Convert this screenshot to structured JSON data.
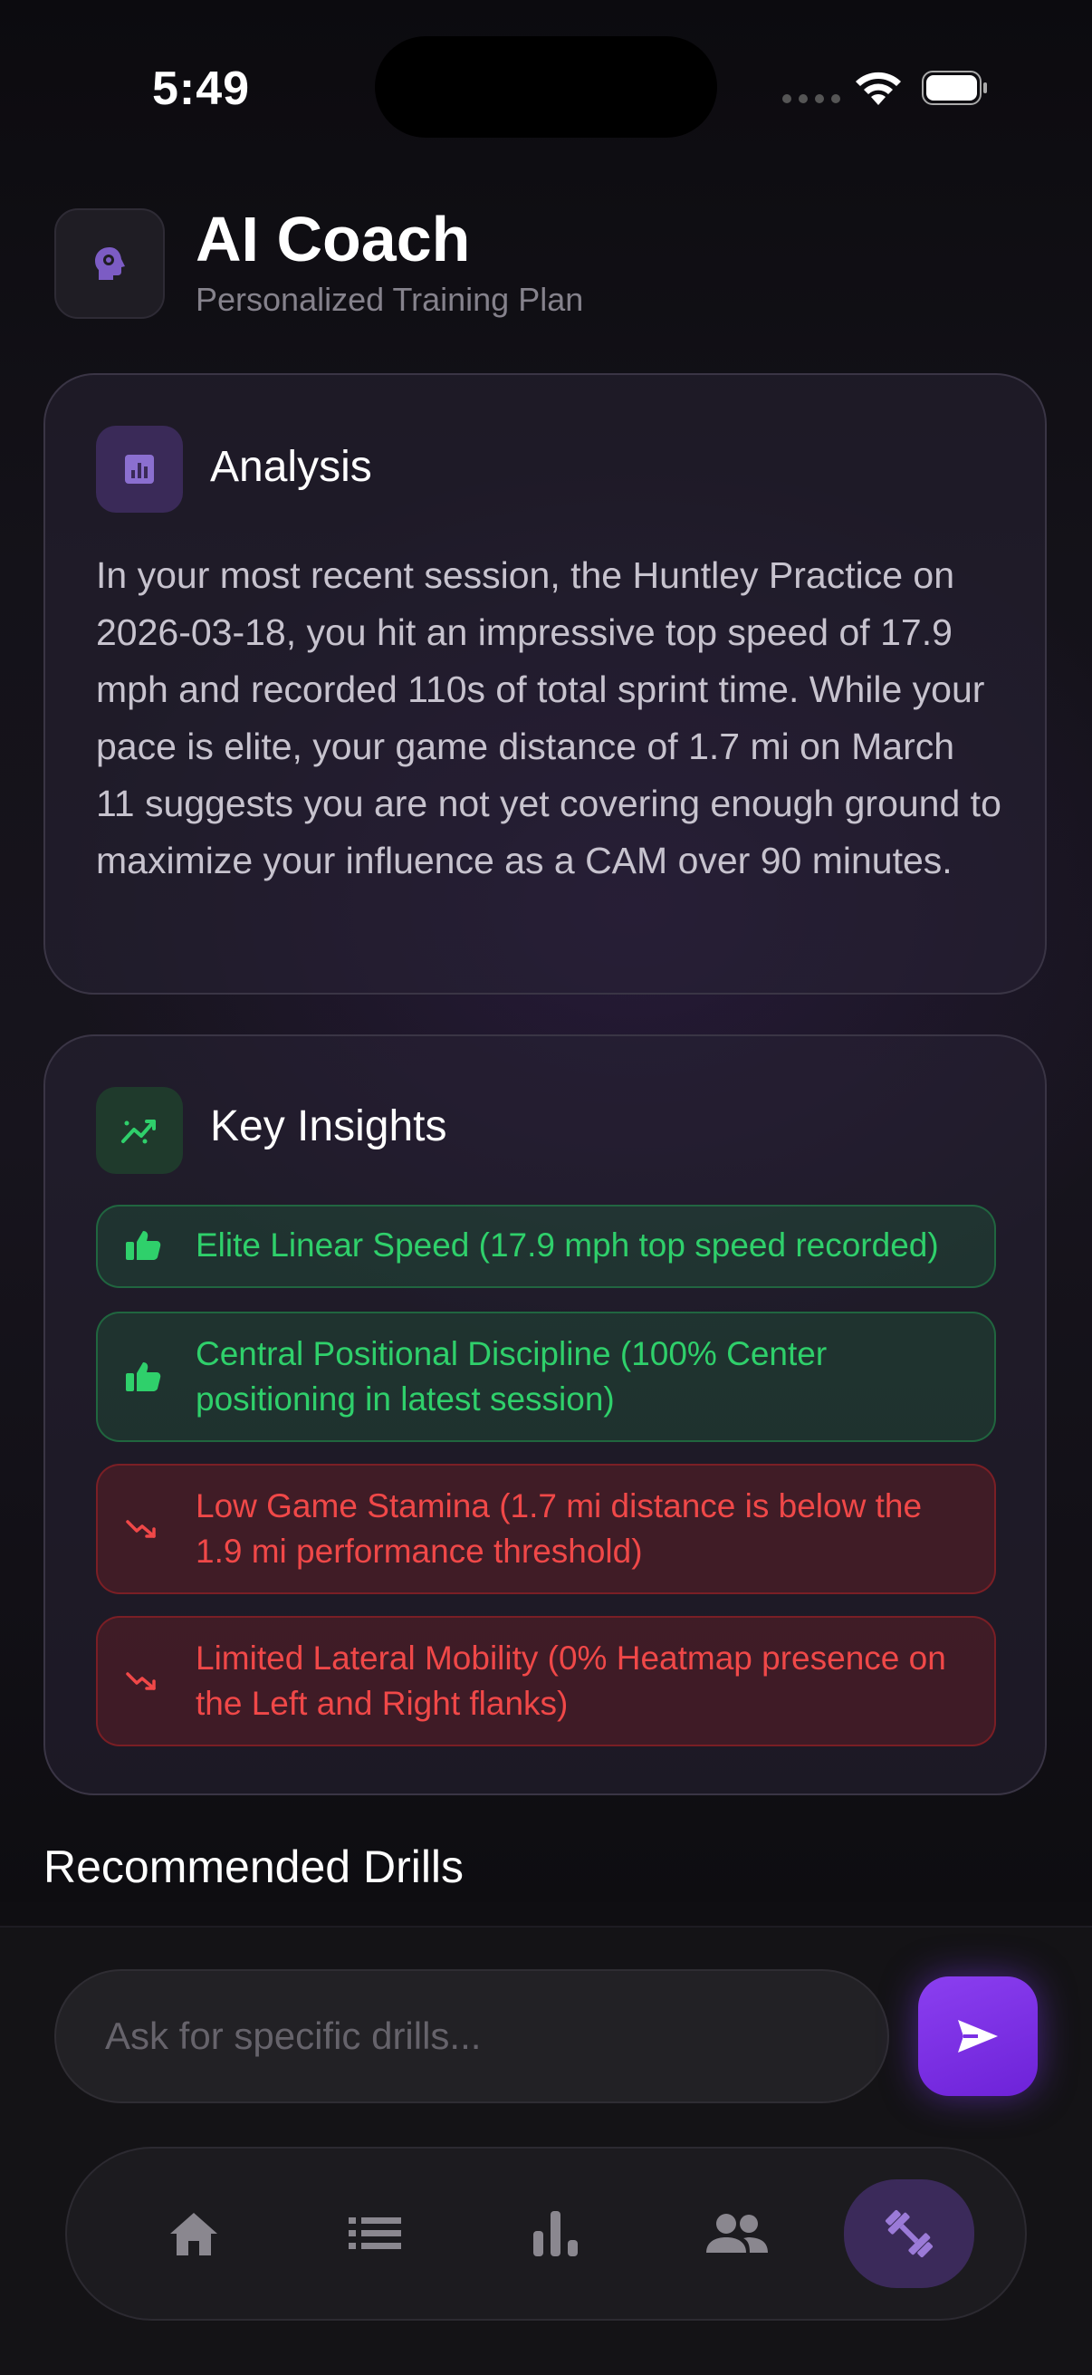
{
  "status_bar": {
    "time": "5:49"
  },
  "header": {
    "title": "AI Coach",
    "subtitle": "Personalized Training Plan"
  },
  "analysis": {
    "title": "Analysis",
    "body": "In your most recent session, the Huntley Practice on 2026-03-18, you hit an impressive top speed of 17.9 mph and recorded 110s of total sprint time. While your pace is elite, your game distance of 1.7 mi on March 11 suggests you are not yet covering enough ground to maximize your influence as a CAM over 90 minutes."
  },
  "insights": {
    "title": "Key Insights",
    "items": [
      {
        "text": "Elite Linear Speed (17.9 mph top speed recorded)",
        "type": "positive",
        "icon": "thumbs-up-icon"
      },
      {
        "text": "Central Positional Discipline (100% Center positioning in latest session)",
        "type": "positive",
        "icon": "thumbs-up-icon"
      },
      {
        "text": "Low Game Stamina (1.7 mi distance is below the 1.9 mi performance threshold)",
        "type": "negative",
        "icon": "trending-down-icon"
      },
      {
        "text": "Limited Lateral Mobility (0% Heatmap presence on the Left and Right flanks)",
        "type": "negative",
        "icon": "trending-down-icon"
      }
    ]
  },
  "drills": {
    "title": "Recommended Drills"
  },
  "composer": {
    "placeholder": "Ask for specific drills..."
  },
  "tab_bar": {
    "tabs": [
      {
        "name": "home",
        "icon": "home-icon",
        "active": false
      },
      {
        "name": "list",
        "icon": "list-icon",
        "active": false
      },
      {
        "name": "stats",
        "icon": "bar-chart-icon",
        "active": false
      },
      {
        "name": "team",
        "icon": "people-icon",
        "active": false
      },
      {
        "name": "training",
        "icon": "dumbbell-icon",
        "active": true
      }
    ]
  },
  "colors": {
    "accent": "#7c3aed",
    "positive": "#2fd06b",
    "negative": "#f04848",
    "background": "#0f0e12"
  }
}
